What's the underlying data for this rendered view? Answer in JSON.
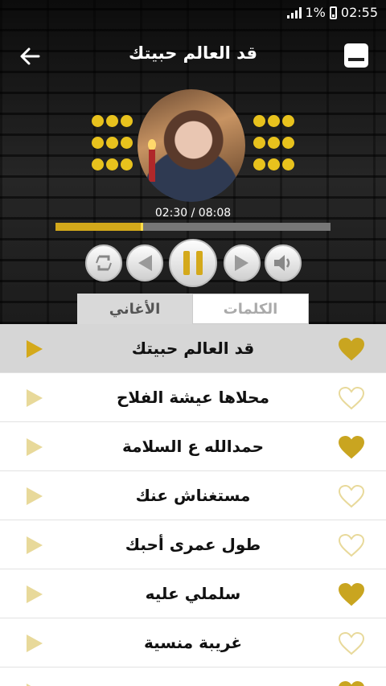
{
  "status": {
    "battery_text": "1%",
    "time": "02:55"
  },
  "header": {
    "title": "قد العالم حبيتك"
  },
  "player": {
    "elapsed": "02:30",
    "total": "08:08",
    "time_text": "02:30 / 08:08",
    "progress": 0.32
  },
  "tabs": {
    "lyrics": "الكلمات",
    "songs": "الأغاني"
  },
  "icons": {
    "back": "arrow-left-icon",
    "menu": "menu-icon",
    "repeat": "repeat-icon",
    "previous": "previous-icon",
    "pause": "pause-icon",
    "next": "next-icon",
    "volume": "volume-icon",
    "heart": "heart-icon",
    "play": "play-icon"
  },
  "colors": {
    "accent": "#D4A91B",
    "heart_filled": "#C9A520",
    "play_faded": "#E8D99A"
  },
  "songs": [
    {
      "title": "قد العالم حبيتك",
      "favorite": true,
      "active": true
    },
    {
      "title": "محلاها عيشة الفلاح",
      "favorite": false,
      "active": false
    },
    {
      "title": "حمدالله ع السلامة",
      "favorite": true,
      "active": false
    },
    {
      "title": "مستغناش عنك",
      "favorite": false,
      "active": false
    },
    {
      "title": "طول عمرى أحبك",
      "favorite": false,
      "active": false
    },
    {
      "title": "سلملي عليه",
      "favorite": true,
      "active": false
    },
    {
      "title": "غريبة منسية",
      "favorite": false,
      "active": false
    },
    {
      "title": "",
      "favorite": true,
      "active": false
    }
  ]
}
